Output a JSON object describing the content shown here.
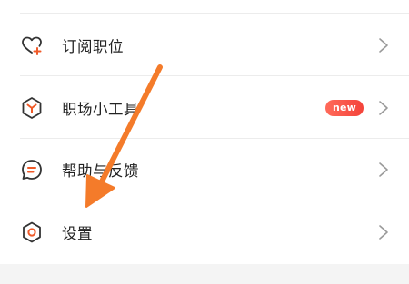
{
  "menu": {
    "items": [
      {
        "label": "订阅职位",
        "icon": "heart-plus-icon",
        "badge": ""
      },
      {
        "label": "职场小工具",
        "icon": "hexagon-y-icon",
        "badge": "new"
      },
      {
        "label": "帮助与反馈",
        "icon": "chat-bubble-icon",
        "badge": ""
      },
      {
        "label": "设置",
        "icon": "gear-icon",
        "badge": ""
      }
    ]
  },
  "colors": {
    "accent": "#f05a28",
    "icon_stroke": "#333333",
    "badge": "#f4433a",
    "annotation_arrow": "#f47b2a"
  }
}
